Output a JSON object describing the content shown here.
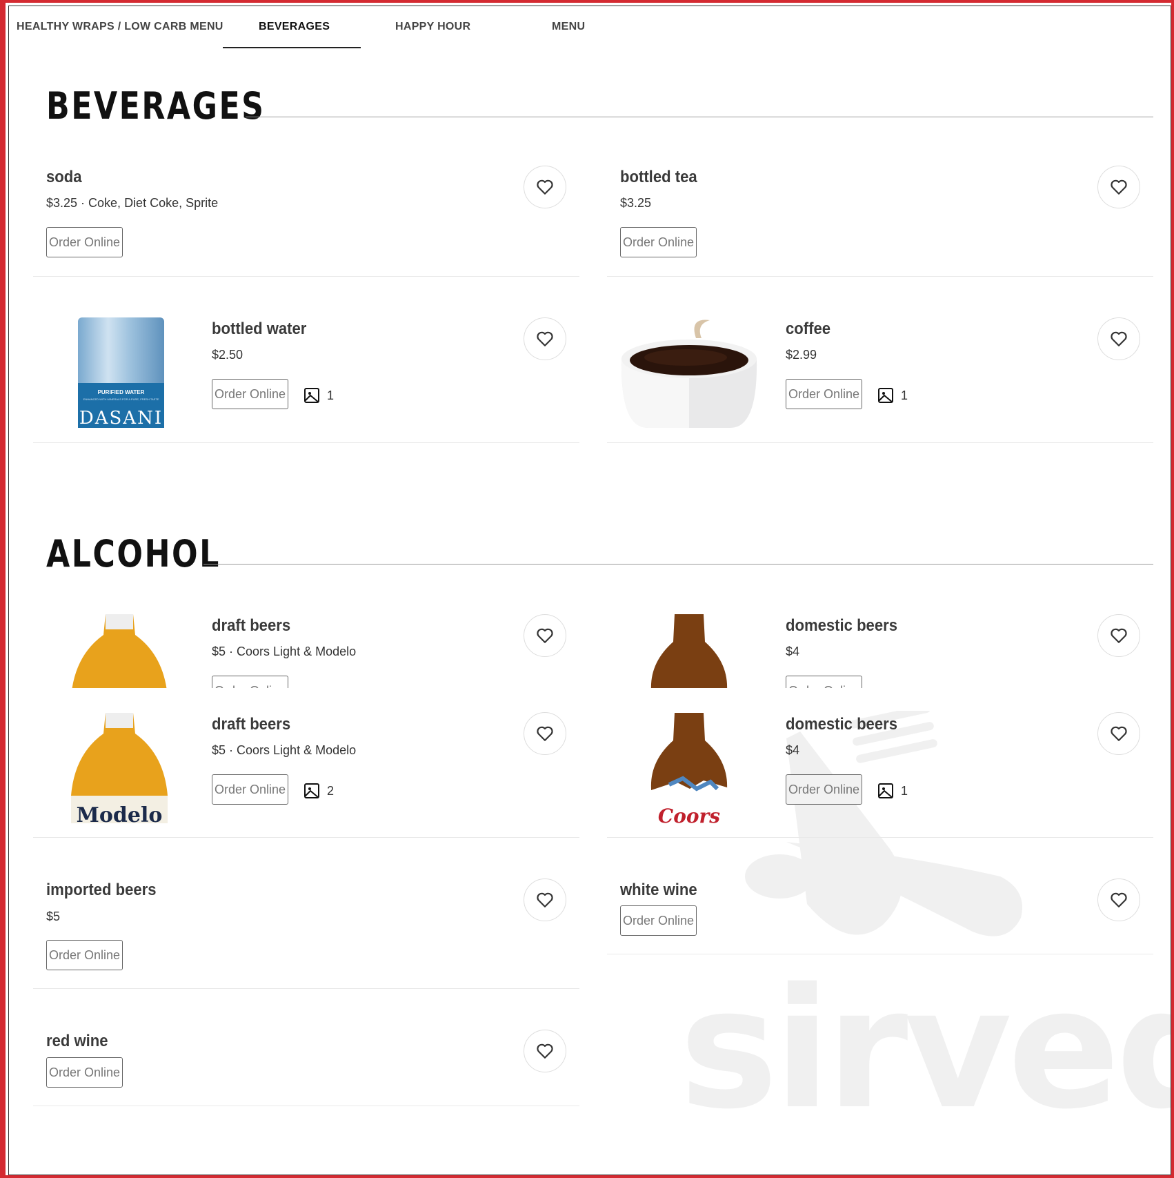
{
  "tabs": [
    {
      "label": "HEALTHY WRAPS / LOW CARB MENU"
    },
    {
      "label": "BEVERAGES"
    },
    {
      "label": "HAPPY HOUR"
    },
    {
      "label": "MENU"
    }
  ],
  "sections": {
    "beverages": {
      "title": "BEVERAGES"
    },
    "alcohol": {
      "title": "ALCOHOL"
    }
  },
  "order_label": "Order Online",
  "watermark": "sirved",
  "items": {
    "soda": {
      "name": "soda",
      "desc": "$3.25 · Coke, Diet Coke, Sprite"
    },
    "bottled_tea": {
      "name": "bottled tea",
      "desc": "$3.25"
    },
    "bottled_water": {
      "name": "bottled water",
      "desc": "$2.50",
      "photo_count": "1",
      "bottle_label": "PURIFIED WATER",
      "bottle_sublabel": "ENHANCED WITH MINERALS FOR A PURE, FRESH TASTE",
      "bottle_brand": "DASANI"
    },
    "coffee": {
      "name": "coffee",
      "desc": "$2.99",
      "photo_count": "1"
    },
    "draft_beers": {
      "name": "draft beers",
      "desc": "$5 · Coors Light & Modelo",
      "photo_count": "2",
      "bottle_brand": "Modelo"
    },
    "domestic_beers": {
      "name": "domestic beers",
      "desc": "$4",
      "photo_count": "1",
      "bottle_brand": "Coors"
    },
    "imported_beers": {
      "name": "imported beers",
      "desc": "$5"
    },
    "white_wine": {
      "name": "white wine"
    },
    "red_wine": {
      "name": "red wine"
    }
  },
  "colors": {
    "frame": "#d42a31",
    "text": "#3a3a3a"
  },
  "icons": [
    "heart-icon",
    "image-icon"
  ]
}
